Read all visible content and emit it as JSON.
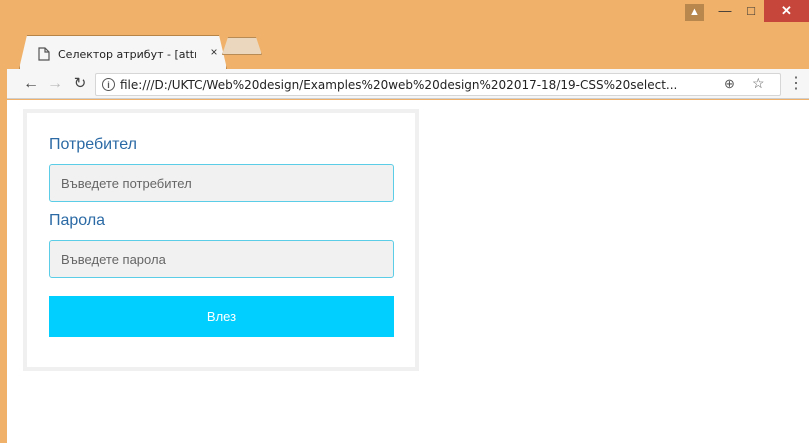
{
  "browser": {
    "tab_title": "Селектор атрибут - [attr",
    "tab_close": "×",
    "url": "file:///D:/UKTC/Web%20design/Examples%20web%20design%202017-18/19-CSS%20select...",
    "icons": {
      "back": "arrow-left-icon",
      "forward": "arrow-right-icon",
      "reload": "reload-icon",
      "info": "info-icon",
      "zoom": "zoom-icon",
      "star": "star-icon",
      "menu": "menu-dots-icon",
      "page": "page-icon",
      "user": "user-icon"
    },
    "titlebar_color": "#f0b26a",
    "close_color": "#c7463b"
  },
  "form": {
    "username_label": "Потребител",
    "username_placeholder": "Въведете потребител",
    "password_label": "Парола",
    "password_placeholder": "Въведете парола",
    "submit_label": "Влез",
    "label_color": "#2b6aa5",
    "button_color": "#00cfff",
    "input_border_color": "#5ccde6"
  }
}
